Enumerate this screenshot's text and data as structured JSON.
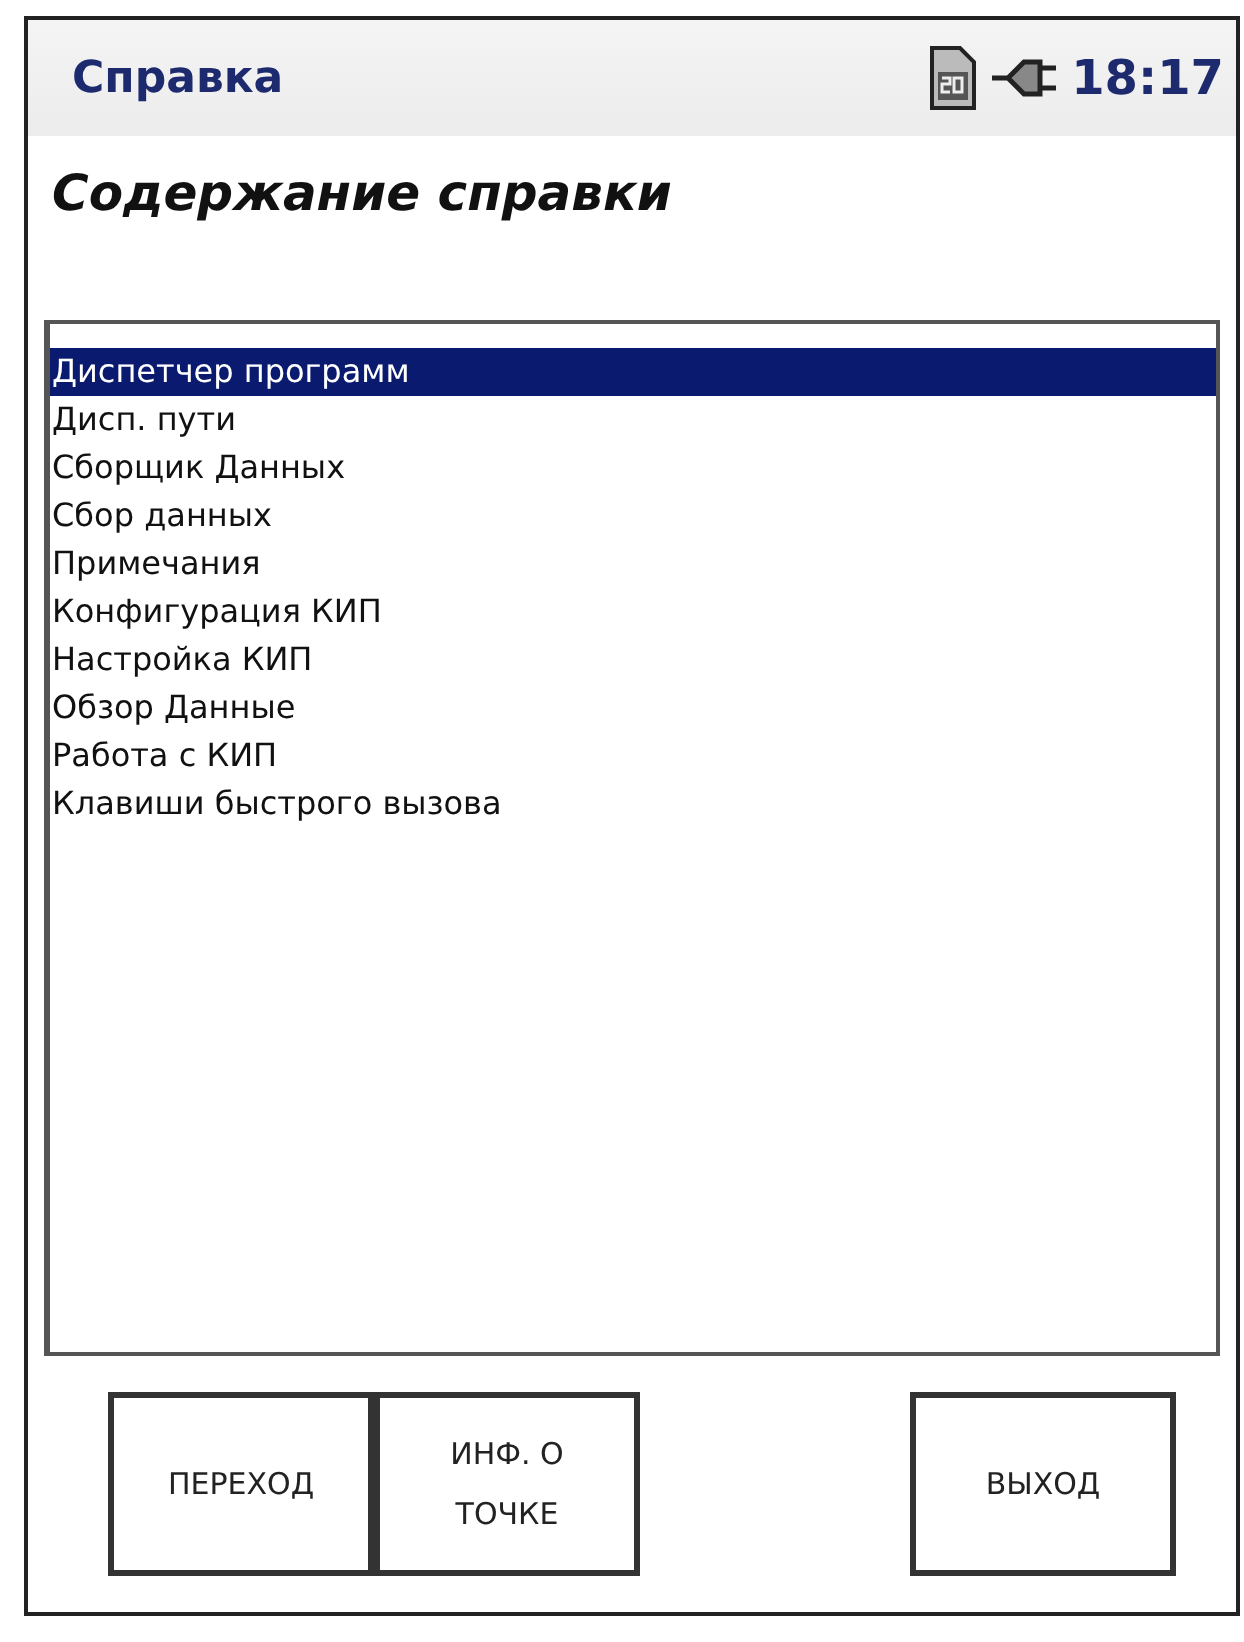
{
  "title_bar": {
    "title": "Справка",
    "time": "18:17"
  },
  "heading": "Содержание справки",
  "list": {
    "items": [
      {
        "label": "Диспетчер программ",
        "selected": true
      },
      {
        "label": "Дисп. пути",
        "selected": false
      },
      {
        "label": "Сборщик Данных",
        "selected": false
      },
      {
        "label": "Сбор данных",
        "selected": false
      },
      {
        "label": "Примечания",
        "selected": false
      },
      {
        "label": "Конфигурация КИП",
        "selected": false
      },
      {
        "label": "Настройка КИП",
        "selected": false
      },
      {
        "label": "Обзор Данные",
        "selected": false
      },
      {
        "label": "Работа с КИП",
        "selected": false
      },
      {
        "label": "Клавиши быстрого вызова",
        "selected": false
      }
    ]
  },
  "buttons_left": [
    "ПЕРЕХОД",
    "ИНФ. О ТОЧКЕ"
  ],
  "buttons_right": [
    "ВЫХОД"
  ]
}
